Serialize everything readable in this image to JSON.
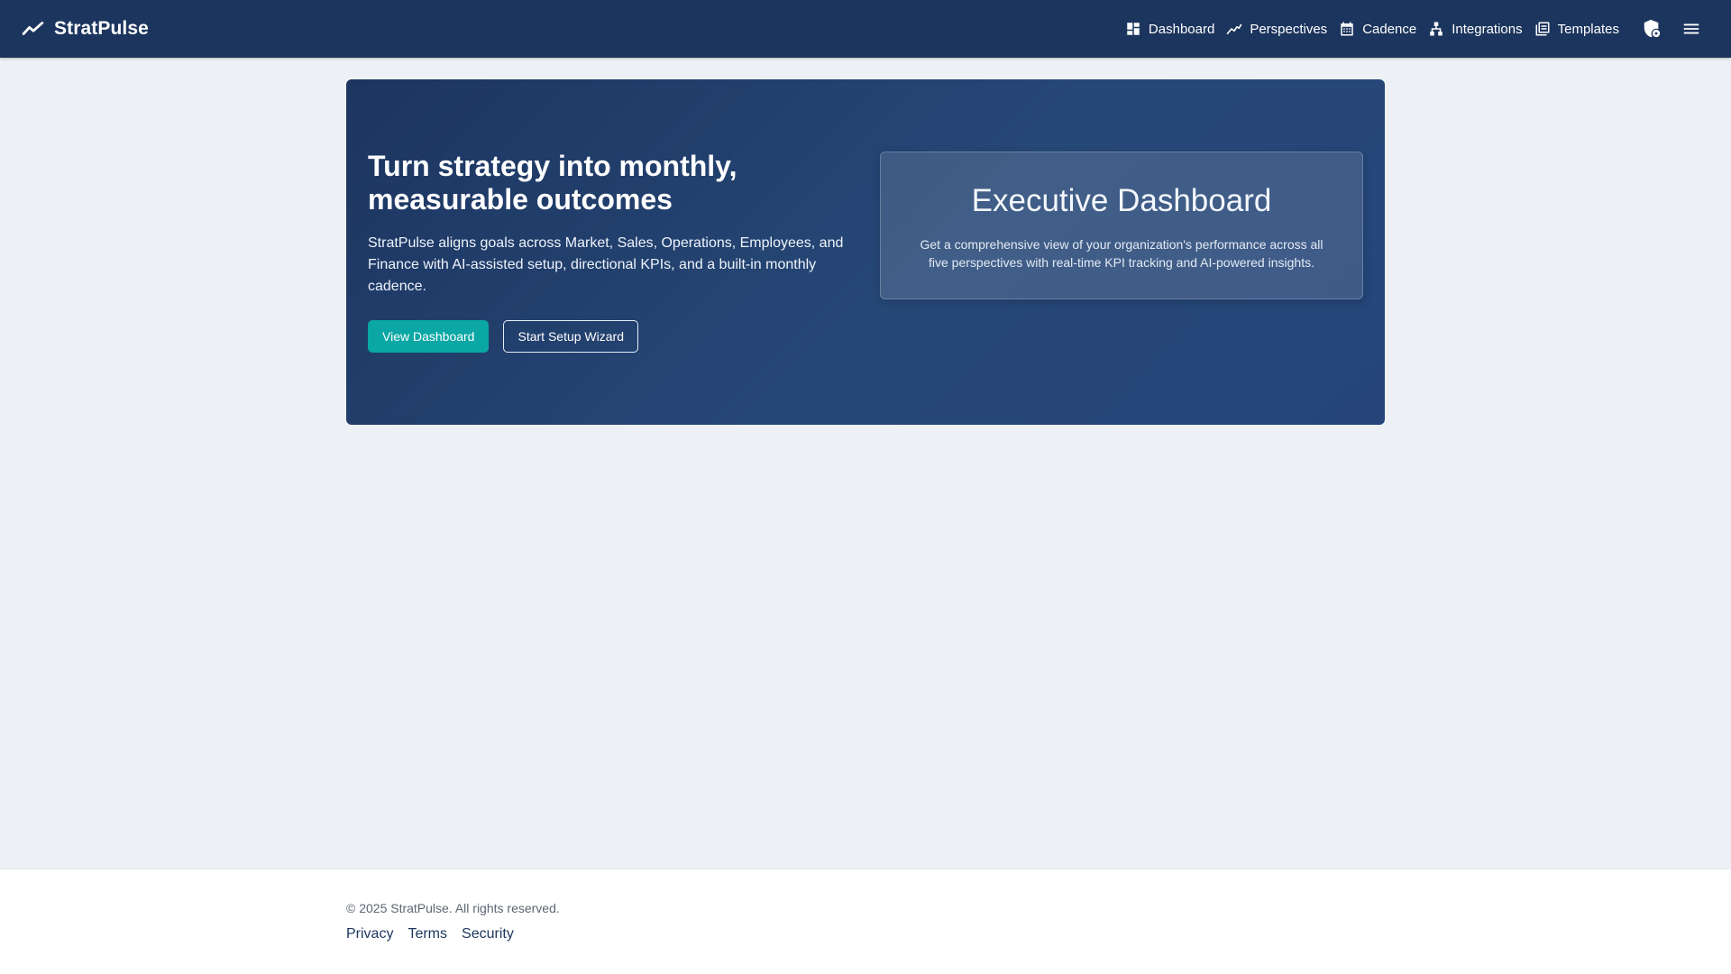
{
  "navbar": {
    "brand": "StratPulse",
    "items": [
      {
        "label": "Dashboard",
        "icon": "dashboard-icon"
      },
      {
        "label": "Perspectives",
        "icon": "trending-icon"
      },
      {
        "label": "Cadence",
        "icon": "calendar-icon"
      },
      {
        "label": "Integrations",
        "icon": "hierarchy-icon"
      },
      {
        "label": "Templates",
        "icon": "library-icon"
      }
    ],
    "extra_icons": [
      "security-policy-icon",
      "menu-icon"
    ]
  },
  "hero": {
    "title": "Turn strategy into monthly, measurable outcomes",
    "description": "StratPulse aligns goals across Market, Sales, Operations, Employees, and Finance with AI-assisted setup, directional KPIs, and a built-in monthly cadence.",
    "primary_button": "View Dashboard",
    "secondary_button": "Start Setup Wizard",
    "card": {
      "title": "Executive Dashboard",
      "description": "Get a comprehensive view of your organization's performance across all five perspectives with real-time KPI tracking and AI-powered insights."
    }
  },
  "footer": {
    "copyright": "© 2025 StratPulse. All rights reserved.",
    "links": [
      "Privacy",
      "Terms",
      "Security"
    ]
  },
  "colors": {
    "navbar_bg": "#1c355e",
    "page_bg": "#edf1f6",
    "accent": "#0aa7a4"
  }
}
